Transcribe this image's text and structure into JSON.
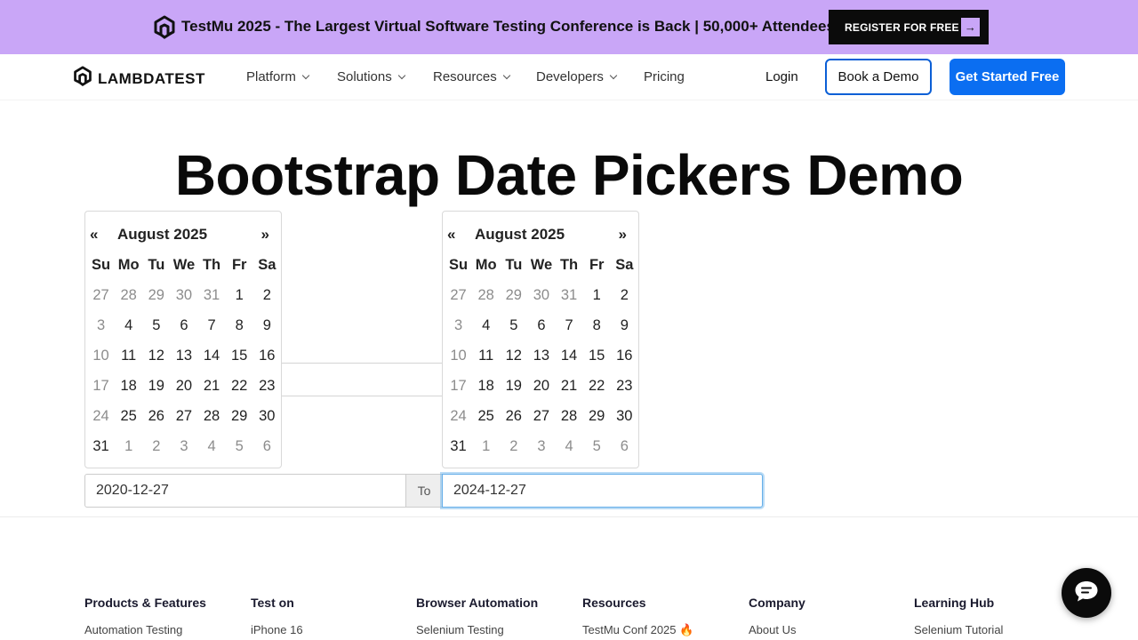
{
  "promo": {
    "text": "TestMu 2025 - The Largest Virtual Software Testing Conference is Back | 50,000+ Attendees",
    "button": "REGISTER FOR FREE",
    "arrow": "→"
  },
  "nav": {
    "brand": "LAMBDATEST",
    "items": [
      "Platform",
      "Solutions",
      "Resources",
      "Developers",
      "Pricing"
    ],
    "login": "Login",
    "demo": "Book a Demo",
    "start": "Get Started Free"
  },
  "hero": {
    "title": "Bootstrap Date Pickers Demo"
  },
  "calendars": [
    {
      "prev": "«",
      "next": "»",
      "month": "August 2025",
      "dow": [
        "Su",
        "Mo",
        "Tu",
        "We",
        "Th",
        "Fr",
        "Sa"
      ],
      "weeks": [
        [
          {
            "d": "27",
            "m": 1
          },
          {
            "d": "28",
            "m": 1
          },
          {
            "d": "29",
            "m": 1
          },
          {
            "d": "30",
            "m": 1
          },
          {
            "d": "31",
            "m": 1
          },
          {
            "d": "1",
            "m": 0
          },
          {
            "d": "2",
            "m": 0
          }
        ],
        [
          {
            "d": "3",
            "m": 1
          },
          {
            "d": "4",
            "m": 0
          },
          {
            "d": "5",
            "m": 0
          },
          {
            "d": "6",
            "m": 0
          },
          {
            "d": "7",
            "m": 0
          },
          {
            "d": "8",
            "m": 0
          },
          {
            "d": "9",
            "m": 0
          }
        ],
        [
          {
            "d": "10",
            "m": 1
          },
          {
            "d": "11",
            "m": 0
          },
          {
            "d": "12",
            "m": 0
          },
          {
            "d": "13",
            "m": 0
          },
          {
            "d": "14",
            "m": 0
          },
          {
            "d": "15",
            "m": 0
          },
          {
            "d": "16",
            "m": 0
          }
        ],
        [
          {
            "d": "17",
            "m": 1
          },
          {
            "d": "18",
            "m": 0
          },
          {
            "d": "19",
            "m": 0
          },
          {
            "d": "20",
            "m": 0
          },
          {
            "d": "21",
            "m": 0
          },
          {
            "d": "22",
            "m": 0
          },
          {
            "d": "23",
            "m": 0
          }
        ],
        [
          {
            "d": "24",
            "m": 1
          },
          {
            "d": "25",
            "m": 0
          },
          {
            "d": "26",
            "m": 0
          },
          {
            "d": "27",
            "m": 0
          },
          {
            "d": "28",
            "m": 0
          },
          {
            "d": "29",
            "m": 0
          },
          {
            "d": "30",
            "m": 0
          }
        ],
        [
          {
            "d": "31",
            "m": 0
          },
          {
            "d": "1",
            "m": 1
          },
          {
            "d": "2",
            "m": 1
          },
          {
            "d": "3",
            "m": 1
          },
          {
            "d": "4",
            "m": 1
          },
          {
            "d": "5",
            "m": 1
          },
          {
            "d": "6",
            "m": 1
          }
        ]
      ]
    },
    {
      "prev": "«",
      "next": "»",
      "month": "August 2025",
      "dow": [
        "Su",
        "Mo",
        "Tu",
        "We",
        "Th",
        "Fr",
        "Sa"
      ],
      "weeks": [
        [
          {
            "d": "27",
            "m": 1
          },
          {
            "d": "28",
            "m": 1
          },
          {
            "d": "29",
            "m": 1
          },
          {
            "d": "30",
            "m": 1
          },
          {
            "d": "31",
            "m": 1
          },
          {
            "d": "1",
            "m": 0
          },
          {
            "d": "2",
            "m": 0
          }
        ],
        [
          {
            "d": "3",
            "m": 1
          },
          {
            "d": "4",
            "m": 0
          },
          {
            "d": "5",
            "m": 0
          },
          {
            "d": "6",
            "m": 0
          },
          {
            "d": "7",
            "m": 0
          },
          {
            "d": "8",
            "m": 0
          },
          {
            "d": "9",
            "m": 0
          }
        ],
        [
          {
            "d": "10",
            "m": 1
          },
          {
            "d": "11",
            "m": 0
          },
          {
            "d": "12",
            "m": 0
          },
          {
            "d": "13",
            "m": 0
          },
          {
            "d": "14",
            "m": 0
          },
          {
            "d": "15",
            "m": 0
          },
          {
            "d": "16",
            "m": 0
          }
        ],
        [
          {
            "d": "17",
            "m": 1
          },
          {
            "d": "18",
            "m": 0
          },
          {
            "d": "19",
            "m": 0
          },
          {
            "d": "20",
            "m": 0
          },
          {
            "d": "21",
            "m": 0
          },
          {
            "d": "22",
            "m": 0
          },
          {
            "d": "23",
            "m": 0
          }
        ],
        [
          {
            "d": "24",
            "m": 1
          },
          {
            "d": "25",
            "m": 0
          },
          {
            "d": "26",
            "m": 0
          },
          {
            "d": "27",
            "m": 0
          },
          {
            "d": "28",
            "m": 0
          },
          {
            "d": "29",
            "m": 0
          },
          {
            "d": "30",
            "m": 0
          }
        ],
        [
          {
            "d": "31",
            "m": 0
          },
          {
            "d": "1",
            "m": 1
          },
          {
            "d": "2",
            "m": 1
          },
          {
            "d": "3",
            "m": 1
          },
          {
            "d": "4",
            "m": 1
          },
          {
            "d": "5",
            "m": 1
          },
          {
            "d": "6",
            "m": 1
          }
        ]
      ]
    }
  ],
  "range": {
    "start": "2020-12-27",
    "to": "To",
    "end": "2024-12-27"
  },
  "footer": {
    "columns": [
      {
        "head": "Products & Features",
        "link": "Automation Testing"
      },
      {
        "head": "Test on",
        "link": "iPhone 16"
      },
      {
        "head": "Browser Automation",
        "link": "Selenium Testing"
      },
      {
        "head": "Resources",
        "link": "TestMu Conf 2025 🔥"
      },
      {
        "head": "Company",
        "link": "About Us"
      },
      {
        "head": "Learning Hub",
        "link": "Selenium Tutorial"
      }
    ]
  },
  "icons": {
    "promo_logo": "lambdatest-logo-icon",
    "brand_logo": "lambdatest-logo-icon",
    "chevron": "chevron-down-icon",
    "chat": "chat-icon"
  },
  "colors": {
    "promo_bg": "#c9a6f7",
    "primary": "#0b6ef1",
    "focus": "#66afe9"
  }
}
